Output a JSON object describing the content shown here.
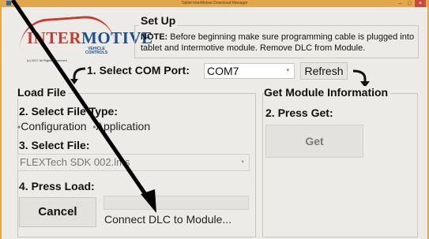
{
  "window": {
    "title": "Tablet InterMotive Download Manager",
    "min_glyph": "–",
    "max_glyph": "□",
    "close_glyph": "×"
  },
  "logo": {
    "brand_part1": "INTER",
    "brand_part2": "MOTIVE",
    "sub_line1": "VEHICLE",
    "sub_line2": "CONTROLS",
    "copyright": "(c) 2017 All Rights Reserved"
  },
  "setup": {
    "title": "Set Up",
    "note_label": "NOTE:",
    "note_text": " Before beginning make sure programming cable is plugged into tablet and Intermotive module. Remove DLC from Module."
  },
  "com_port": {
    "label": "1. Select COM Port:",
    "value": "COM7",
    "refresh_label": "Refresh"
  },
  "load_file": {
    "title": "Load File",
    "file_type_label": "2. Select File Type:",
    "option_configuration": "Configuration",
    "option_application": "Application",
    "select_file_label": "3. Select File:",
    "file_value": "FLEXTech SDK 002.lms",
    "press_load_label": "4. Press Load:",
    "cancel_label": "Cancel",
    "status_text": "Connect DLC to Module..."
  },
  "module_info": {
    "title": "Get Module Information",
    "press_get_label": "2. Press Get:",
    "get_label": "Get"
  },
  "colors": {
    "titlebar": "#e3a64d",
    "brand_red": "#c73b2f",
    "brand_blue": "#1d4e8f",
    "window_bg": "#ecebe7"
  }
}
